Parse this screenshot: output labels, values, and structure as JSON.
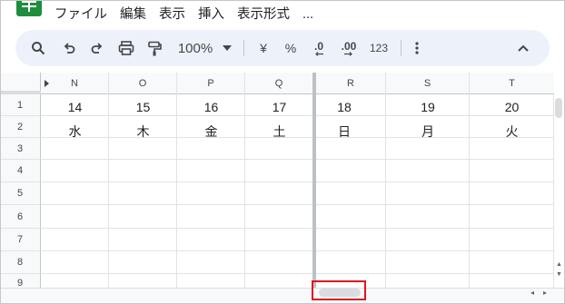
{
  "menu": {
    "items": [
      "ファイル",
      "編集",
      "表示",
      "挿入",
      "表示形式",
      "..."
    ]
  },
  "toolbar": {
    "zoom": "100%",
    "currency": "¥",
    "percent": "%",
    "decrease_decimal": ".0",
    "increase_decimal": ".00",
    "number_format": "123",
    "icons": [
      "search-icon",
      "undo-icon",
      "redo-icon",
      "print-icon",
      "paint-format-icon",
      "zoom-dropdown-icon",
      "more-vert-icon",
      "collapse-icon"
    ]
  },
  "grid": {
    "columns": [
      "N",
      "O",
      "P",
      "Q",
      "R",
      "S",
      "T"
    ],
    "rows": [
      "1",
      "2",
      "3",
      "4",
      "5",
      "6",
      "7",
      "8",
      "9"
    ],
    "row1": [
      "14",
      "15",
      "16",
      "17",
      "18",
      "19",
      "20"
    ],
    "row2": [
      "水",
      "木",
      "金",
      "土",
      "日",
      "月",
      "火"
    ]
  },
  "colors": {
    "accent": "#1e8e3e",
    "toolbar_bg": "#edf2fa",
    "highlight_box": "#e0141e"
  }
}
